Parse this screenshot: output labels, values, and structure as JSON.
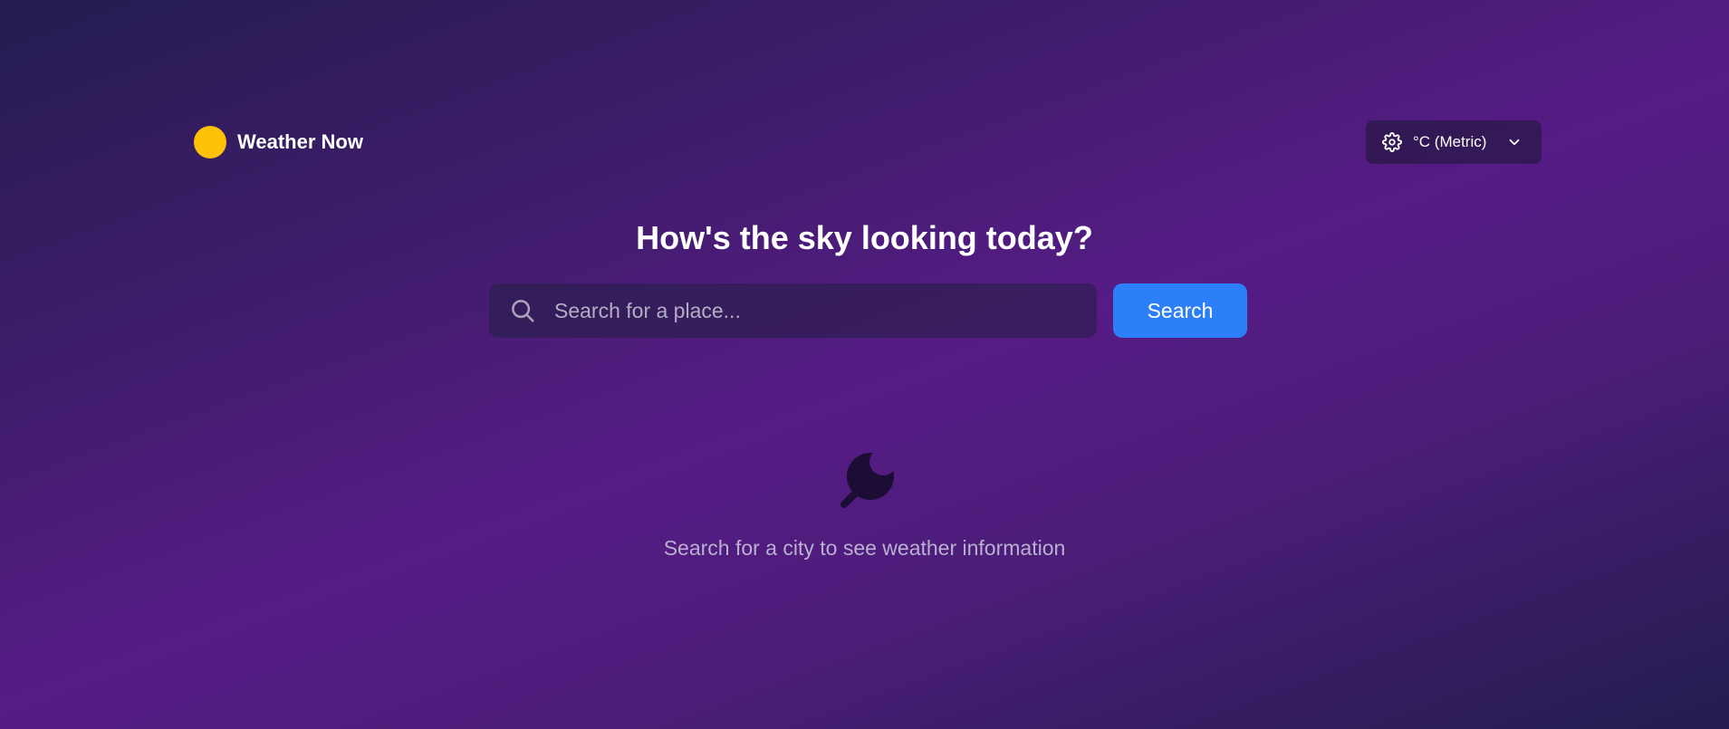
{
  "colors": {
    "brand_logo": "#ffc107",
    "search_button": "#2d7ff9",
    "background_start": "#231c4f",
    "background_mid": "#561b85"
  },
  "header": {
    "app_title": "Weather Now",
    "logo_icon": "sun-icon",
    "units": {
      "icon": "gear-icon",
      "selected": "°C (Metric)",
      "chevron_icon": "chevron-down-icon"
    }
  },
  "main": {
    "headline": "How's the sky looking today?",
    "search": {
      "icon": "search-icon",
      "placeholder": "Search for a place...",
      "value": "",
      "button_label": "Search"
    },
    "empty_state": {
      "icon": "search-placeholder-icon",
      "message": "Search for a city to see weather information"
    }
  }
}
